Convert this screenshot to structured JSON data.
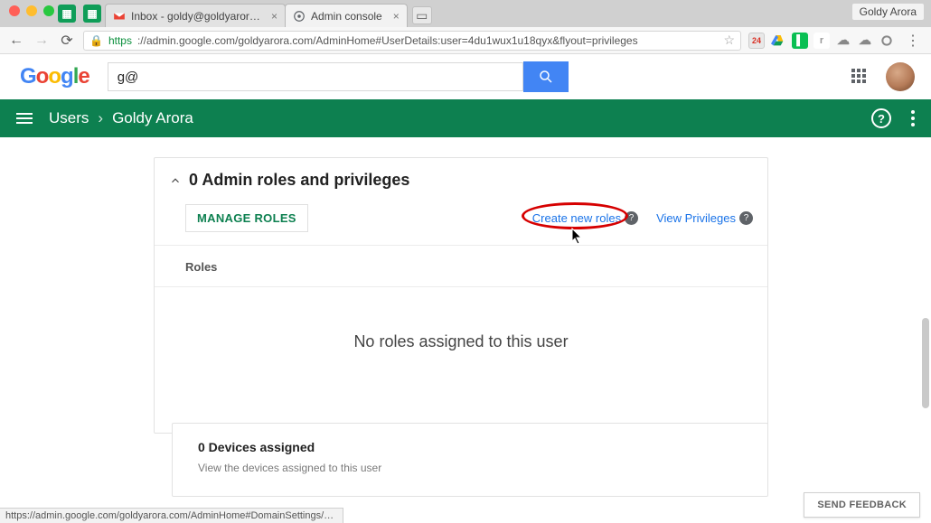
{
  "chrome": {
    "profile_name": "Goldy Arora",
    "tabs": [
      {
        "title": "Inbox - goldy@goldyarora.com",
        "favicon": "gmail-icon"
      },
      {
        "title": "Admin console",
        "favicon": "admin-icon"
      }
    ],
    "url_secure": "https",
    "url_rest": "://admin.google.com/goldyarora.com/AdminHome#UserDetails:user=4du1wux1u18qyx&flyout=privileges",
    "status_hover_url": "https://admin.google.com/goldyarora.com/AdminHome#DomainSettings/subt...",
    "ext_cal_badge": "24"
  },
  "google": {
    "logo_letters": [
      "G",
      "o",
      "o",
      "g",
      "l",
      "e"
    ],
    "search_value": "g@"
  },
  "adminbar": {
    "breadcrumb_root": "Users",
    "breadcrumb_current": "Goldy Arora"
  },
  "roles_card": {
    "title": "0 Admin roles and privileges",
    "manage_button": "MANAGE ROLES",
    "create_link": "Create new roles",
    "view_link": "View Privileges",
    "section_label": "Roles",
    "empty_message": "No roles assigned to this user"
  },
  "devices_card": {
    "title": "0 Devices assigned",
    "subtitle": "View the devices assigned to this user"
  },
  "footer": {
    "send_feedback": "SEND FEEDBACK"
  },
  "colors": {
    "admin_green": "#0d8050",
    "link_blue": "#1a73e8",
    "annotation_red": "#d60000"
  }
}
